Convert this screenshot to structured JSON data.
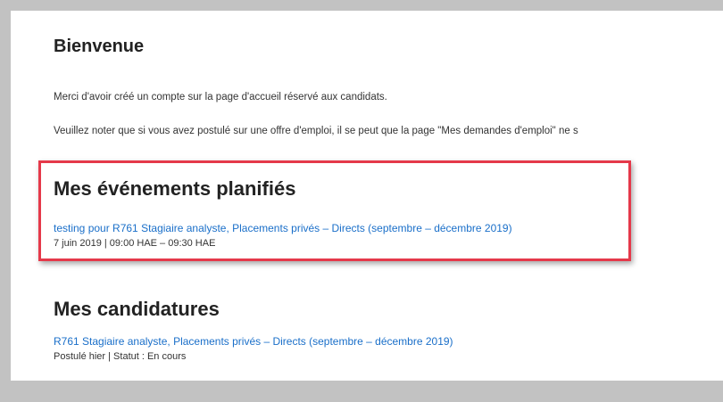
{
  "welcome": {
    "title": "Bienvenue",
    "paragraph1": "Merci d'avoir créé un compte sur la page d'accueil réservé aux candidats.",
    "paragraph2": "Veuillez noter que si vous avez postulé sur une offre d'emploi, il se peut que la page \"Mes demandes d'emploi\" ne s"
  },
  "events": {
    "title": "Mes événements planifiés",
    "items": [
      {
        "link": "testing pour R761 Stagiaire analyste, Placements privés – Directs (septembre – décembre 2019)",
        "meta": "7 juin 2019 | 09:00 HAE – 09:30 HAE"
      }
    ]
  },
  "applications": {
    "title": "Mes candidatures",
    "items": [
      {
        "link": "R761 Stagiaire analyste, Placements privés – Directs (septembre – décembre 2019)",
        "meta": "Postulé hier | Statut : En cours"
      }
    ]
  },
  "colors": {
    "background": "#c2c2c2",
    "panel": "#ffffff",
    "link": "#1a6fc9",
    "highlight": "#e5394a"
  }
}
